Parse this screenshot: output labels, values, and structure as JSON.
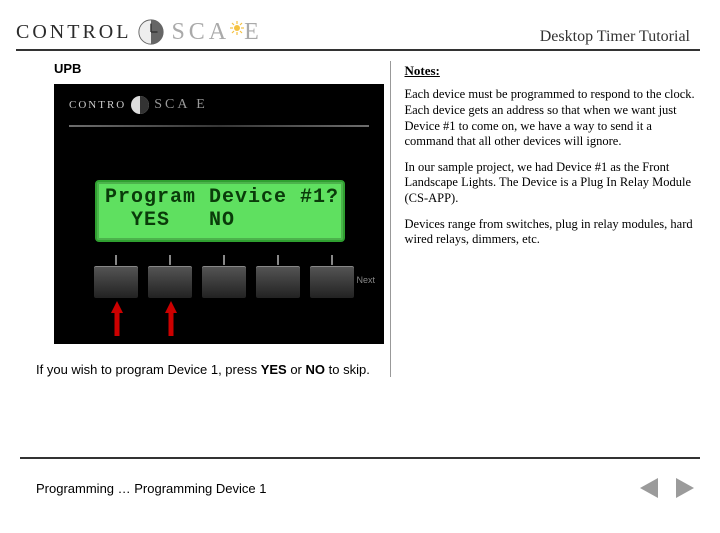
{
  "header": {
    "logo_word1": "CONTROL",
    "logo_word2": "SCA  E",
    "title": "Desktop Timer Tutorial"
  },
  "left": {
    "section": "UPB",
    "lcd_line1": "Program Device #1?",
    "lcd_line2": "  YES   NO",
    "side_next": "Next",
    "side_back": "",
    "instruction_pre": "If you wish to program Device 1, press ",
    "instruction_yes": "YES",
    "instruction_mid": " or ",
    "instruction_no": "NO",
    "instruction_post": " to skip."
  },
  "notes": {
    "heading": "Notes:",
    "p1": "Each device must be programmed to respond to the clock. Each device gets an address so that when we want just Device #1 to come on, we have a way to send it a command that all other devices will ignore.",
    "p2": "In our sample project, we had Device #1 as the Front Landscape Lights. The Device is a Plug In Relay Module (CS-APP).",
    "p3": "Devices range from switches, plug in relay modules, hard wired relays, dimmers, etc."
  },
  "footer": {
    "breadcrumb": "Programming … Programming Device 1"
  }
}
